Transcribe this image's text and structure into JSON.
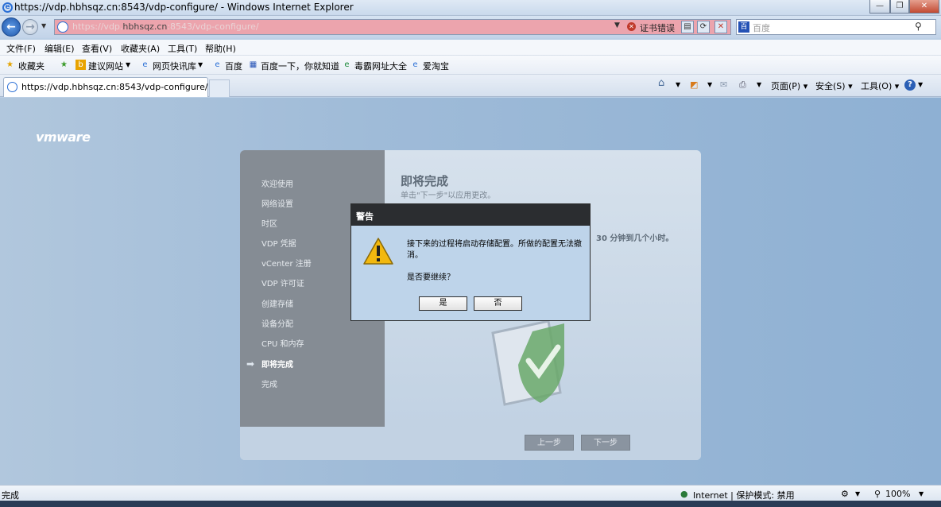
{
  "window": {
    "title": "https://vdp.hbhsqz.cn:8543/vdp-configure/ - Windows Internet Explorer"
  },
  "address": {
    "url_prefix": "https://vdp.",
    "url_host": "hbhsqz.cn",
    "url_suffix": ":8543/vdp-configure/",
    "cert_error": "证书错误"
  },
  "search": {
    "placeholder": "百度"
  },
  "menu": [
    "文件(F)",
    "编辑(E)",
    "查看(V)",
    "收藏夹(A)",
    "工具(T)",
    "帮助(H)"
  ],
  "favorites": {
    "label": "收藏夹",
    "items": [
      "建议网站",
      "网页快讯库",
      "百度",
      "百度一下，你就知道",
      "毒霸网址大全",
      "爱淘宝"
    ]
  },
  "tab": {
    "title": "https://vdp.hbhsqz.cn:8543/vdp-configure/"
  },
  "commandbar": {
    "page": "页面(P)",
    "safety": "安全(S)",
    "tools": "工具(O)"
  },
  "content": {
    "logo": "vmware",
    "sidebar": [
      "欢迎使用",
      "网络设置",
      "时区",
      "VDP 凭据",
      "vCenter 注册",
      "VDP 许可证",
      "创建存储",
      "设备分配",
      "CPU 和内存",
      "即将完成",
      "完成"
    ],
    "current_step_index": 9,
    "heading": "即将完成",
    "subheading": "单击\"下一步\"以应用更改。",
    "note": "30 分钟到几个小时。",
    "prev_button": "上一步",
    "next_button": "下一步"
  },
  "dialog": {
    "title": "警告",
    "message": "接下来的过程将启动存储配置。所做的配置无法撤消。",
    "question": "是否要继续？",
    "yes": "是",
    "no": "否"
  },
  "status": {
    "left": "完成",
    "zone": "Internet | 保护模式: 禁用",
    "zoom": "100%"
  },
  "colors": {
    "dialog_bg": "#bed4ea",
    "header_dark": "#2b2d30",
    "sidebar": "#858c94",
    "address_error": "#eca4ad"
  }
}
